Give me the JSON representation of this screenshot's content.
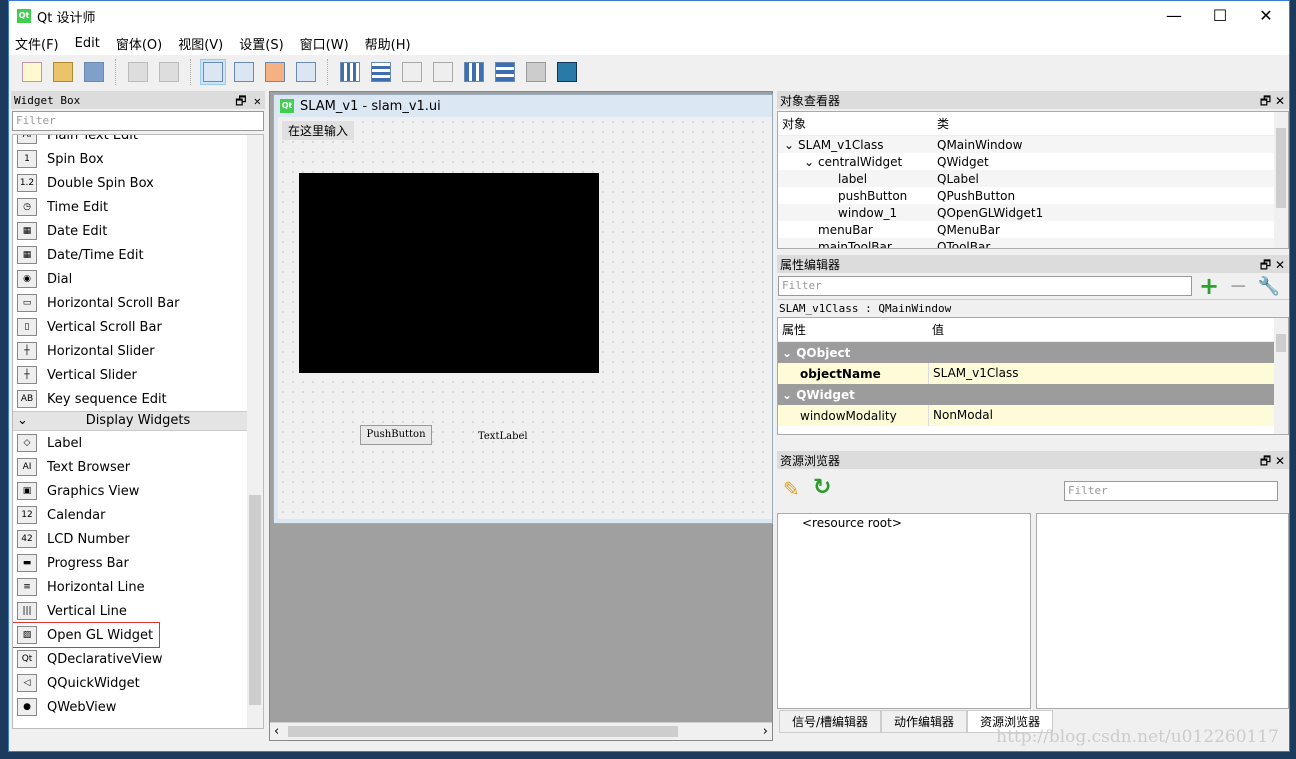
{
  "window": {
    "title": "Qt 设计师",
    "controls": [
      "—",
      "☐",
      "✕"
    ]
  },
  "menu": [
    "文件(F)",
    "Edit",
    "窗体(O)",
    "视图(V)",
    "设置(S)",
    "窗口(W)",
    "帮助(H)"
  ],
  "toolbar": [
    "new",
    "open",
    "save",
    "bring-to-front",
    "send-to-back",
    "edit-widgets",
    "edit-signals-slots",
    "edit-buddies",
    "edit-tab-order",
    "layout-horizontal",
    "layout-vertical",
    "layout-h-splitter",
    "layout-v-splitter",
    "layout-grid",
    "layout-form",
    "break-layout",
    "adjust-size"
  ],
  "widget_box": {
    "title": "Widget Box",
    "filter_placeholder": "Filter",
    "input_items": [
      {
        "label": "Plain Text Edit",
        "icon": "AI"
      },
      {
        "label": "Spin Box",
        "icon": "1"
      },
      {
        "label": "Double Spin Box",
        "icon": "1.2"
      },
      {
        "label": "Time Edit",
        "icon": "◷"
      },
      {
        "label": "Date Edit",
        "icon": "▦"
      },
      {
        "label": "Date/Time Edit",
        "icon": "▦"
      },
      {
        "label": "Dial",
        "icon": "◉"
      },
      {
        "label": "Horizontal Scroll Bar",
        "icon": "▭"
      },
      {
        "label": "Vertical Scroll Bar",
        "icon": "▯"
      },
      {
        "label": "Horizontal Slider",
        "icon": "┼"
      },
      {
        "label": "Vertical Slider",
        "icon": "┼"
      },
      {
        "label": "Key sequence Edit",
        "icon": "AB"
      }
    ],
    "category": "Display Widgets",
    "display_items": [
      {
        "label": "Label",
        "icon": "◇"
      },
      {
        "label": "Text Browser",
        "icon": "AI"
      },
      {
        "label": "Graphics View",
        "icon": "▣"
      },
      {
        "label": "Calendar",
        "icon": "12"
      },
      {
        "label": "LCD Number",
        "icon": "42"
      },
      {
        "label": "Progress Bar",
        "icon": "▬"
      },
      {
        "label": "Horizontal Line",
        "icon": "≡"
      },
      {
        "label": "Vertical Line",
        "icon": "|||"
      },
      {
        "label": "Open GL Widget",
        "icon": "▨"
      },
      {
        "label": "QDeclarativeView",
        "icon": "Qt"
      },
      {
        "label": "QQuickWidget",
        "icon": "◁"
      },
      {
        "label": "QWebView",
        "icon": "●"
      }
    ]
  },
  "form": {
    "title": "SLAM_v1 - slam_v1.ui",
    "menu_placeholder": "在这里输入",
    "push_button": "PushButton",
    "text_label": "TextLabel"
  },
  "object_inspector": {
    "title": "对象查看器",
    "col_object": "对象",
    "col_class": "类",
    "rows": [
      {
        "name": "SLAM_v1Class",
        "cls": "QMainWindow",
        "depth": 0,
        "expand": "⌄"
      },
      {
        "name": "centralWidget",
        "cls": "QWidget",
        "depth": 1,
        "expand": "⌄"
      },
      {
        "name": "label",
        "cls": "QLabel",
        "depth": 2,
        "expand": ""
      },
      {
        "name": "pushButton",
        "cls": "QPushButton",
        "depth": 2,
        "expand": ""
      },
      {
        "name": "window_1",
        "cls": "QOpenGLWidget1",
        "depth": 2,
        "expand": ""
      },
      {
        "name": "menuBar",
        "cls": "QMenuBar",
        "depth": 1,
        "expand": ""
      },
      {
        "name": "mainToolBar",
        "cls": "QToolBar",
        "depth": 1,
        "expand": ""
      }
    ]
  },
  "property_editor": {
    "title": "属性编辑器",
    "filter_placeholder": "Filter",
    "context": "SLAM_v1Class : QMainWindow",
    "col_prop": "属性",
    "col_value": "值",
    "rows": [
      {
        "type": "group",
        "name": "QObject"
      },
      {
        "type": "prop",
        "name": "objectName",
        "value": "SLAM_v1Class",
        "bold": true
      },
      {
        "type": "group",
        "name": "QWidget"
      },
      {
        "type": "prop",
        "name": "windowModality",
        "value": "NonModal"
      }
    ]
  },
  "resource_browser": {
    "title": "资源浏览器",
    "filter_placeholder": "Filter",
    "root": "<resource root>"
  },
  "bottom_tabs": [
    {
      "label": "信号/槽编辑器",
      "active": false
    },
    {
      "label": "动作编辑器",
      "active": false
    },
    {
      "label": "资源浏览器",
      "active": true
    }
  ],
  "watermark": "http://blog.csdn.net/u012260117",
  "colors": {
    "highlight_box": "#dd3333",
    "group_row": "#9c9c9c",
    "property_row": "#fefbd8"
  }
}
